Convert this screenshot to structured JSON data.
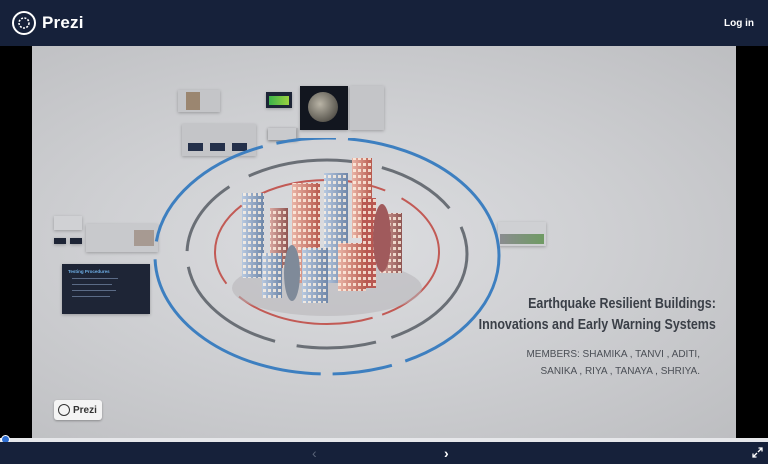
{
  "header": {
    "brand": "Prezi",
    "login_label": "Log in"
  },
  "presentation": {
    "title_line1": "Earthquake Resilient Buildings:",
    "title_line2": "Innovations and Early Warning Systems",
    "members_line1": "MEMBERS: SHAMIKA , TANVI , ADITI,",
    "members_line2": "SANIKA , RIYA , TANAYA , SHRIYA.",
    "side_card_title": "Testing Procedures",
    "badge_label": "Prezi"
  },
  "player": {
    "progress_fraction": 0.0,
    "prev_icon": "‹",
    "next_icon": "›"
  },
  "colors": {
    "header_bg": "#16213a",
    "accent": "#2f6fd3",
    "ring_blue": "#3d7fc0",
    "ring_red": "#c25a55"
  }
}
